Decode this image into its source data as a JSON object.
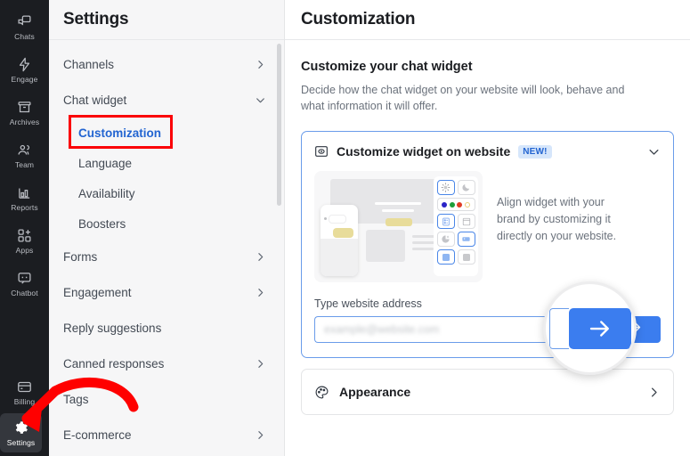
{
  "rail": {
    "top_items": [
      {
        "label": "Chats",
        "icon": "chats-icon"
      },
      {
        "label": "Engage",
        "icon": "engage-bolt-icon"
      },
      {
        "label": "Archives",
        "icon": "archives-box-icon"
      },
      {
        "label": "Team",
        "icon": "team-people-icon"
      },
      {
        "label": "Reports",
        "icon": "reports-bars-icon"
      },
      {
        "label": "Apps",
        "icon": "apps-grid-plus-icon"
      },
      {
        "label": "Chatbot",
        "icon": "chatbot-bubble-icon"
      }
    ],
    "bottom_items": [
      {
        "label": "Billing",
        "icon": "billing-card-icon",
        "active": false
      },
      {
        "label": "Settings",
        "icon": "settings-gear-icon",
        "active": true
      }
    ]
  },
  "settings": {
    "title": "Settings",
    "items": [
      {
        "label": "Channels",
        "type": "group",
        "chevron": "chevron-right-icon"
      },
      {
        "label": "Chat widget",
        "type": "group",
        "chevron": "chevron-down-icon",
        "expanded": true
      },
      {
        "label": "Customization",
        "type": "sub",
        "selected": true,
        "highlighted": true
      },
      {
        "label": "Language",
        "type": "sub"
      },
      {
        "label": "Availability",
        "type": "sub"
      },
      {
        "label": "Boosters",
        "type": "sub"
      },
      {
        "label": "Forms",
        "type": "group",
        "chevron": "chevron-right-icon"
      },
      {
        "label": "Engagement",
        "type": "group",
        "chevron": "chevron-right-icon"
      },
      {
        "label": "Reply suggestions",
        "type": "plain"
      },
      {
        "label": "Canned responses",
        "type": "group",
        "chevron": "chevron-right-icon"
      },
      {
        "label": "Tags",
        "type": "plain"
      },
      {
        "label": "E-commerce",
        "type": "group",
        "chevron": "chevron-right-icon"
      }
    ]
  },
  "main": {
    "header_title": "Customization",
    "intro_title": "Customize your chat widget",
    "intro_desc": "Decide how the chat widget on your website will look, behave and what information it will offer.",
    "promo": {
      "icon": "widget-preview-icon",
      "title": "Customize widget on website",
      "badge": "NEW!",
      "chevron": "chevron-down-icon",
      "text": "Align widget with your brand by customizing it directly on your website.",
      "address_label": "Type website address",
      "address_placeholder": "example@website.com",
      "address_value": "",
      "submit_icon": "arrow-right-icon"
    },
    "appearance": {
      "icon": "palette-icon",
      "label": "Appearance",
      "chevron": "chevron-right-icon"
    }
  },
  "annotation": {
    "arrow": "red-curved-arrow",
    "color": "#ff0000",
    "points_to": "Settings"
  },
  "colors": {
    "accent_blue": "#2264d1",
    "button_blue": "#3b7def",
    "badge_bg": "#d6e6fb",
    "rail_bg": "#1b1d21",
    "panel_bg": "#f6f6f7",
    "highlight_red": "#fb0007"
  },
  "illustration": {
    "swatches": [
      "#2a24c7",
      "#1d9e3a",
      "#e03c24",
      "#f0d58a"
    ],
    "accent_yellow": "#e8dc9a"
  }
}
